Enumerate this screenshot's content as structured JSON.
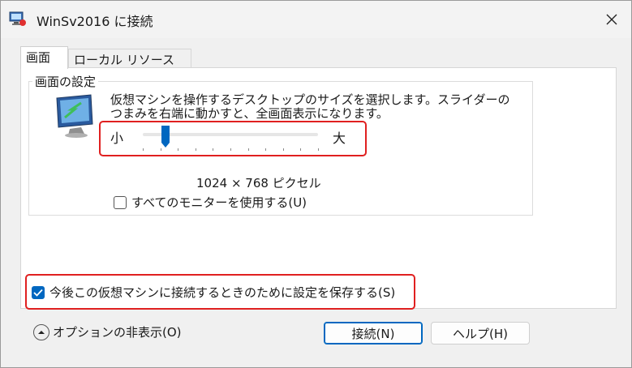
{
  "window": {
    "title": "WinSv2016 に接続"
  },
  "tabs": [
    {
      "label": "画面",
      "active": true
    },
    {
      "label": "ローカル リソース",
      "active": false
    }
  ],
  "display": {
    "group_title": "画面の設定",
    "description": "仮想マシンを操作するデスクトップのサイズを選択します。スライダーのつまみを右端に動かすと、全画面表示になります。",
    "slider": {
      "small_label": "小",
      "large_label": "大",
      "value_fraction": 0.13
    },
    "resolution_text": "1024 × 768 ピクセル",
    "use_all_monitors": {
      "label": "すべてのモニターを使用する(U)",
      "checked": false
    }
  },
  "save_settings": {
    "label": "今後この仮想マシンに接続するときのために設定を保存する(S)",
    "checked": true
  },
  "footer": {
    "options_toggle_label": "オプションの非表示(O)",
    "connect_button": "接続(N)",
    "help_button": "ヘルプ(H)"
  },
  "colors": {
    "accent": "#0067c0",
    "highlight": "#e02020"
  },
  "icons": {
    "app": "hyper-v-connect-icon",
    "close": "close-icon",
    "monitor": "monitor-icon"
  }
}
